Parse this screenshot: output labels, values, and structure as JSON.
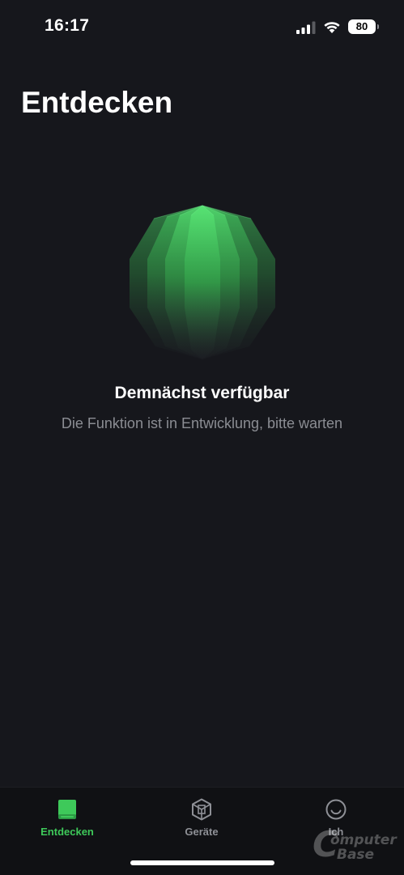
{
  "status_bar": {
    "time": "16:17",
    "battery_level": "80",
    "signal_icon": "cellular-signal-icon",
    "wifi_icon": "wifi-icon"
  },
  "header": {
    "title": "Entdecken"
  },
  "empty_state": {
    "graphic_icon": "green-polyhedron-icon",
    "title": "Demnächst verfügbar",
    "subtitle": "Die Funktion ist in Entwicklung, bitte warten"
  },
  "tab_bar": {
    "tabs": [
      {
        "label": "Entdecken",
        "icon": "book-icon",
        "active": true
      },
      {
        "label": "Geräte",
        "icon": "cube-icon",
        "active": false
      },
      {
        "label": "Ich",
        "icon": "profile-circle-icon",
        "active": false
      }
    ]
  },
  "watermark": {
    "logo": "computerbase-logo",
    "text_c": "C",
    "text_line1": "omputer",
    "text_line2": "Base"
  },
  "colors": {
    "background": "#16171c",
    "tab_bar_background": "#101114",
    "accent_green": "#3ec95a",
    "inactive_tab": "#8e9096",
    "subtitle_text": "#8b8d93"
  }
}
